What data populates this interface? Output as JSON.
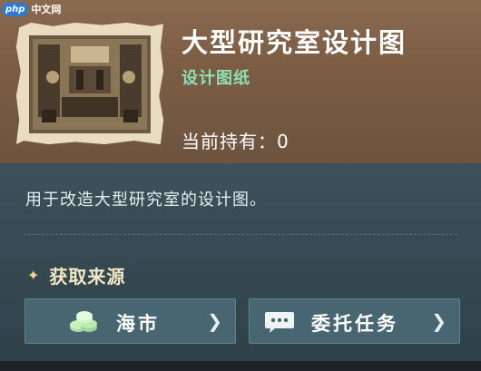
{
  "watermark": {
    "logo": "php",
    "text": "中文网"
  },
  "item": {
    "name": "大型研究室设计图",
    "type": "设计图纸",
    "owned_text": "当前持有：0",
    "description": "用于改造大型研究室的设计图。"
  },
  "source": {
    "heading": "获取来源",
    "buttons": [
      {
        "label": "海市",
        "icon": "coins-icon"
      },
      {
        "label": "委托任务",
        "icon": "chat-bubble-icon"
      }
    ]
  },
  "colors": {
    "header_bg": "#7a5c43",
    "body_bg": "#34474f",
    "type_green": "#8ee0b4",
    "button_bg": "#476672"
  }
}
